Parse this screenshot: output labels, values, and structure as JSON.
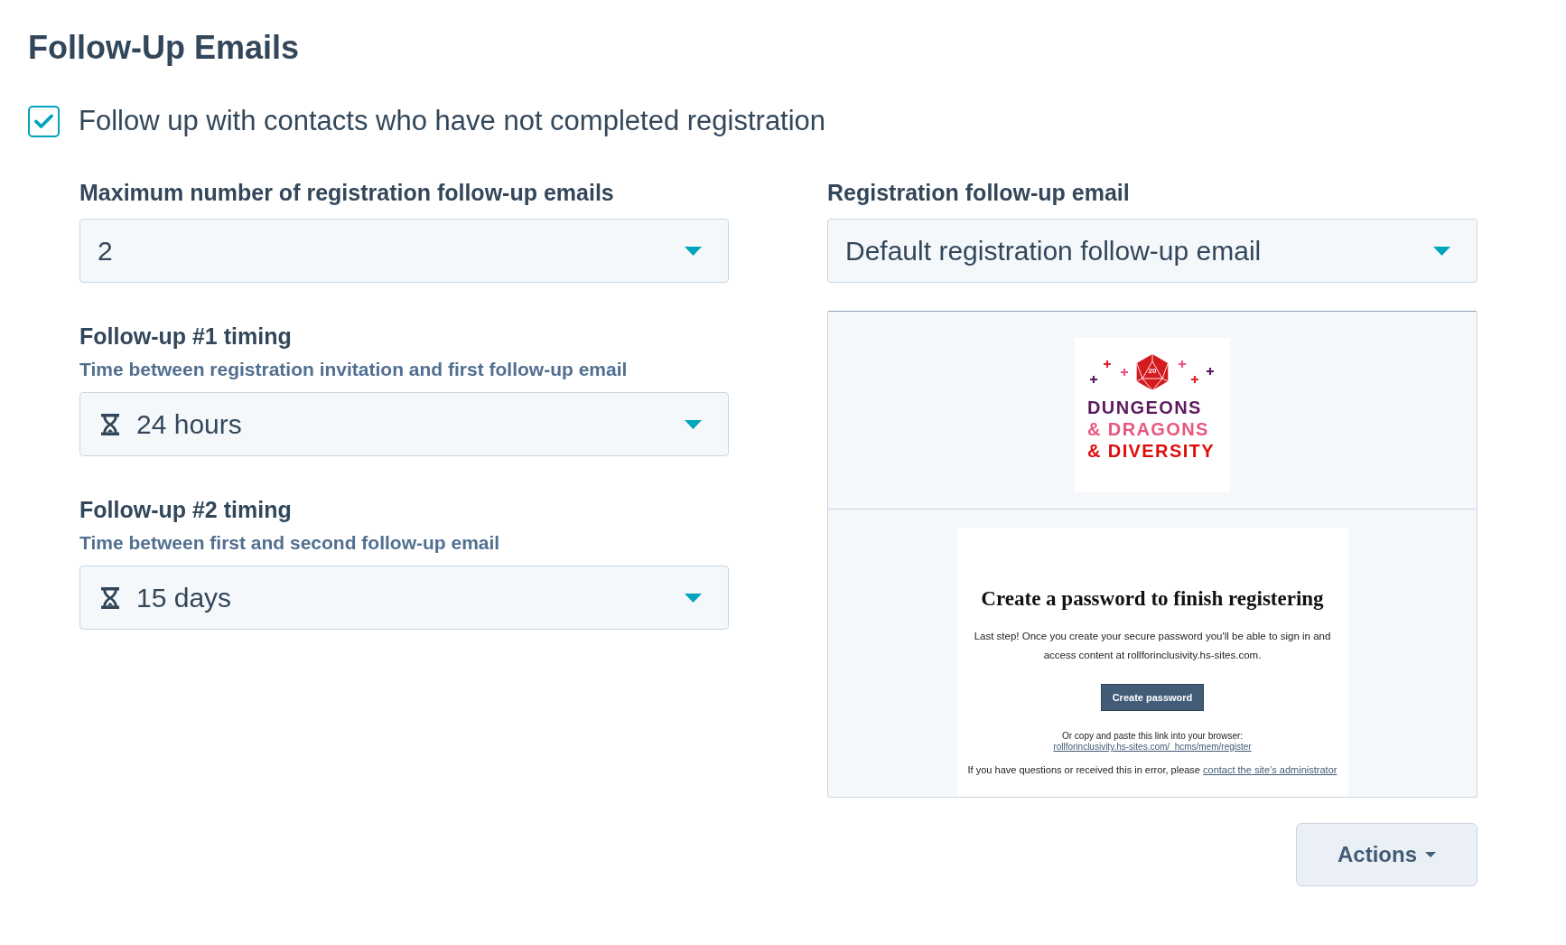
{
  "section": {
    "title": "Follow-Up Emails"
  },
  "follow_up_checkbox": {
    "label": "Follow up with contacts who have not completed registration",
    "checked": true
  },
  "left_fields": [
    {
      "kind": "plain",
      "label": "Maximum number of registration follow-up emails",
      "value": "2"
    },
    {
      "kind": "duration",
      "label": "Follow-up #1 timing",
      "description": "Time between registration invitation and first follow-up email",
      "value": "24 hours"
    },
    {
      "kind": "duration",
      "label": "Follow-up #2 timing",
      "description": "Time between first and second follow-up email",
      "value": "15 days"
    }
  ],
  "email_field": {
    "label": "Registration follow-up email",
    "value": "Default registration follow-up email"
  },
  "email_preview": {
    "logo": {
      "die_number": "20",
      "lines": [
        {
          "text": "DUNGEONS",
          "color": "#5e1a5e"
        },
        {
          "text": "& DRAGONS",
          "color": "#e8587e"
        },
        {
          "text": "& DIVERSITY",
          "color": "#e00c0c"
        }
      ]
    },
    "heading": "Create a password to finish registering",
    "body": "Last step! Once you create your secure password you'll be able to sign in and access content at rollforinclusivity.hs-sites.com.",
    "button": "Create password",
    "link_intro": "Or copy and paste this link into your browser:",
    "link": "rollforinclusivity.hs-sites.com/_hcms/mem/register",
    "footer_text": "If you have questions or received this in error, please",
    "footer_link": "contact the site’s administrator"
  },
  "actions_button": {
    "label": "Actions"
  }
}
